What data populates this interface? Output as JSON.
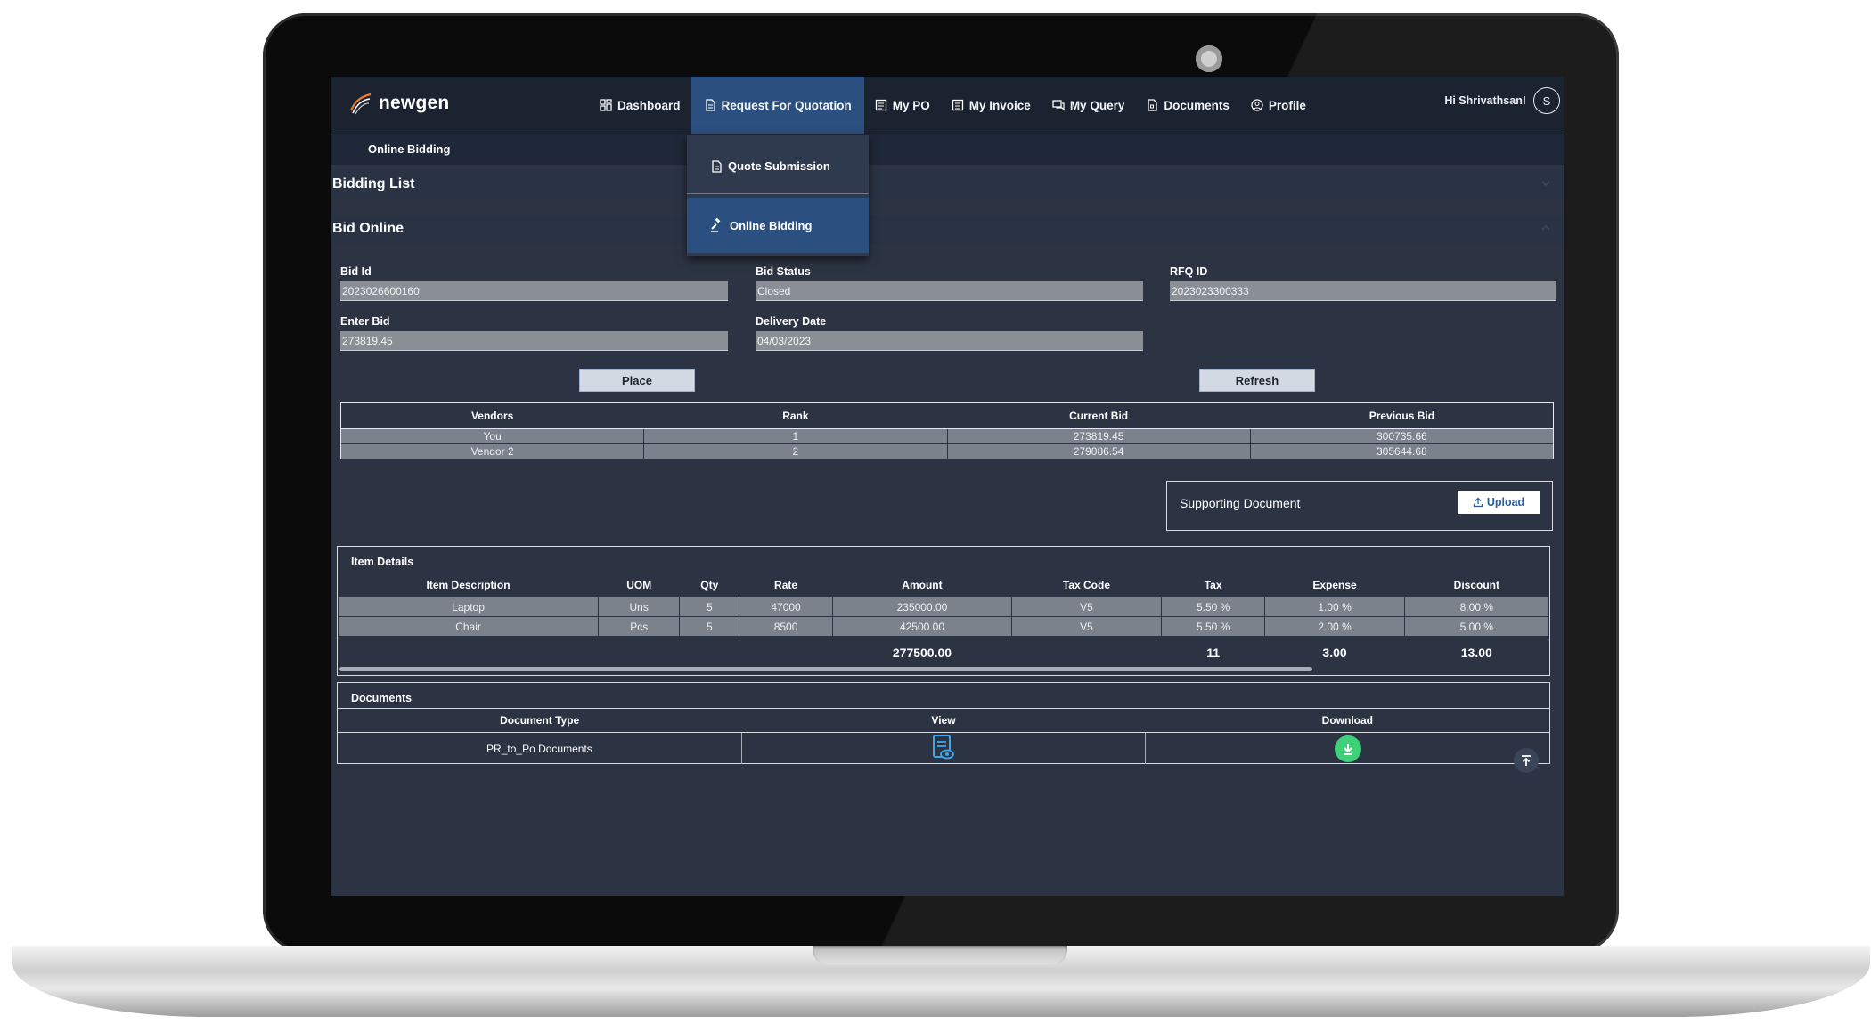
{
  "brand": {
    "name": "newgen"
  },
  "nav": {
    "items": [
      {
        "label": "Dashboard",
        "icon": "dashboard-grid-icon"
      },
      {
        "label": "Request For Quotation",
        "icon": "document-icon",
        "active": true
      },
      {
        "label": "My PO",
        "icon": "list-document-icon"
      },
      {
        "label": "My Invoice",
        "icon": "invoice-icon"
      },
      {
        "label": "My Query",
        "icon": "chat-icon"
      },
      {
        "label": "Documents",
        "icon": "file-icon"
      },
      {
        "label": "Profile",
        "icon": "user-circle-icon"
      }
    ],
    "greeting": "Hi Shrivathsan!",
    "avatar_initial": "S"
  },
  "dropdown": {
    "items": [
      {
        "label": "Quote Submission",
        "icon": "document-icon"
      },
      {
        "label": "Online Bidding",
        "icon": "gavel-icon",
        "active": true
      }
    ]
  },
  "breadcrumb": {
    "current": "Online Bidding"
  },
  "sections": {
    "bidding_list": "Bidding List",
    "bid_online": "Bid Online"
  },
  "form": {
    "bid_id": {
      "label": "Bid Id",
      "value": "2023026600160"
    },
    "bid_status": {
      "label": "Bid Status",
      "value": "Closed"
    },
    "rfq_id": {
      "label": "RFQ ID",
      "value": "2023023300333"
    },
    "enter_bid": {
      "label": "Enter Bid",
      "value": "273819.45"
    },
    "delivery_date": {
      "label": "Delivery Date",
      "value": "04/03/2023"
    }
  },
  "buttons": {
    "place": "Place",
    "refresh": "Refresh",
    "upload": "Upload"
  },
  "bids": {
    "headers": [
      "Vendors",
      "Rank",
      "Current Bid",
      "Previous Bid"
    ],
    "rows": [
      [
        "You",
        "1",
        "273819.45",
        "300735.66"
      ],
      [
        "Vendor 2",
        "2",
        "279086.54",
        "305644.68"
      ]
    ]
  },
  "supporting_document": {
    "label": "Supporting Document"
  },
  "items": {
    "title": "Item Details",
    "headers": [
      "Item Description",
      "UOM",
      "Qty",
      "Rate",
      "Amount",
      "Tax Code",
      "Tax",
      "Expense",
      "Discount"
    ],
    "rows": [
      [
        "Laptop",
        "Uns",
        "5",
        "47000",
        "235000.00",
        "V5",
        "5.50 %",
        "1.00 %",
        "8.00 %"
      ],
      [
        "Chair",
        "Pcs",
        "5",
        "8500",
        "42500.00",
        "V5",
        "5.50 %",
        "2.00 %",
        "5.00 %"
      ]
    ],
    "totals": [
      "",
      "",
      "",
      "",
      "277500.00",
      "",
      "11",
      "3.00",
      "13.00"
    ]
  },
  "documents": {
    "title": "Documents",
    "headers": [
      "Document Type",
      "View",
      "Download"
    ],
    "rows": [
      {
        "type": "PR_to_Po Documents"
      }
    ]
  },
  "colors": {
    "accent": "#2b4f7f",
    "download": "#3ed17a",
    "upload_text": "#2b5d9c"
  }
}
